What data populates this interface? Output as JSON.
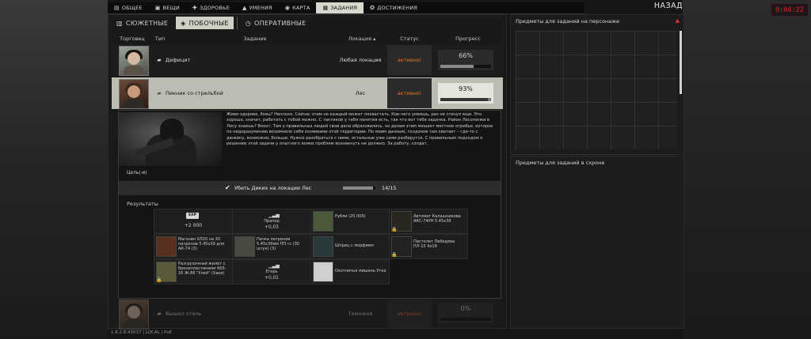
{
  "timer": "0:04:22",
  "nav": {
    "tabs": [
      {
        "label": "ОБЩЕЕ",
        "icon": "document-icon"
      },
      {
        "label": "ВЕЩИ",
        "icon": "bag-icon"
      },
      {
        "label": "ЗДОРОВЬЕ",
        "icon": "health-icon"
      },
      {
        "label": "УМЕНИЯ",
        "icon": "skills-icon"
      },
      {
        "label": "КАРТА",
        "icon": "map-pin-icon"
      },
      {
        "label": "ЗАДАНИЯ",
        "icon": "tasks-icon"
      },
      {
        "label": "ДОСТИЖЕНИЯ",
        "icon": "achievements-icon"
      }
    ],
    "active": "ЗАДАНИЯ",
    "back_label": "НАЗАД"
  },
  "categories": [
    {
      "label": "СЮЖЕТНЫЕ",
      "icon": "book-icon"
    },
    {
      "label": "ПОБОЧНЫЕ",
      "icon": "side-quest-icon"
    },
    {
      "label": "ОПЕРАТИВНЫЕ",
      "icon": "clock-icon"
    }
  ],
  "active_category": "ПОБОЧНЫЕ",
  "columns": {
    "trader": "Торговец",
    "type": "Тип",
    "task": "Задание",
    "location": "Локация",
    "status": "Статус",
    "progress": "Прогресс"
  },
  "quests": [
    {
      "name": "Дефицит",
      "location": "Любая локация",
      "status": "активно!",
      "progress_text": "66%",
      "progress": 0.66
    },
    {
      "name": "Пикник со стрельбой",
      "location": "Лес",
      "status": "активно!",
      "progress_text": "93%",
      "progress": 0.93
    },
    {
      "name": "Вышел отель",
      "location": "Таможня",
      "status": "активно!",
      "progress_text": "0%",
      "progress": 0.0
    }
  ],
  "detail": {
    "description": "Живо-здорово, боец? Неплохо. Сейчас этим не каждый может похвастать. Кое-чего умеешь, раз не сгинул еще. Это хорошо, значит, работать с тобой можно. С тактикой у тебя понятия есть, так что вот тебе задачка. Район Лесопилки в Лесу знаешь? Вооот. Там у правильных людей свои дела образовались, но делам этим мешает местное отребье, которое по недоразумению возомнило себя хозяевами этой территории. По моим данным, гондонов там хватает – где-то с дюжину, возможно, больше. Нужно разобраться с ними, остальные уже сами разберутся. С правильным подходом к решению этой задачи у опытного вояки проблем возникнуть не должно. За работу, солдат.",
    "goals_label": "Цель(-и)",
    "objective": {
      "text": "Убить Диких на локации Лес",
      "count": "14/15",
      "progress": 0.93
    },
    "results_label": "Результаты"
  },
  "rewards": [
    {
      "kind": "exp",
      "badge": "EXP",
      "value": "+2 000"
    },
    {
      "kind": "rep",
      "label": "Прапор",
      "value": "+0,03"
    },
    {
      "kind": "item",
      "label": "Рубли (20 000)",
      "lock": false
    },
    {
      "kind": "item",
      "label": "Автомат Калашникова АКС-74УН 5.45х39",
      "lock": true
    },
    {
      "kind": "item",
      "label": "Магазин 6Л20 на 30 патронов 5.45х39 для АК-74 (3)",
      "lock": false
    },
    {
      "kind": "item",
      "label": "Пачка патронов 5.45х39мм ПП гс (30 штук) (3)",
      "lock": false
    },
    {
      "kind": "item",
      "label": "Шприц с морфием",
      "lock": false
    },
    {
      "kind": "item",
      "label": "Пистолет Лебедева ПЛ-15 9х19",
      "lock": true
    },
    {
      "kind": "item",
      "label": "Разгрузочный жилет с бронепластинами 6Б5-16 Ж-86 \"Улей\" (Хаки)",
      "lock": true
    },
    {
      "kind": "rep",
      "label": "Егерь",
      "value": "+0,01"
    },
    {
      "kind": "item",
      "label": "Охотничья мишень Утка",
      "lock": false
    }
  ],
  "right": {
    "panel1_title": "Предметы для заданий на персонаже",
    "panel2_title": "Предметы для заданий в схроне"
  },
  "footer": "1.8.2.8.43037 | LOCAL | PvE"
}
